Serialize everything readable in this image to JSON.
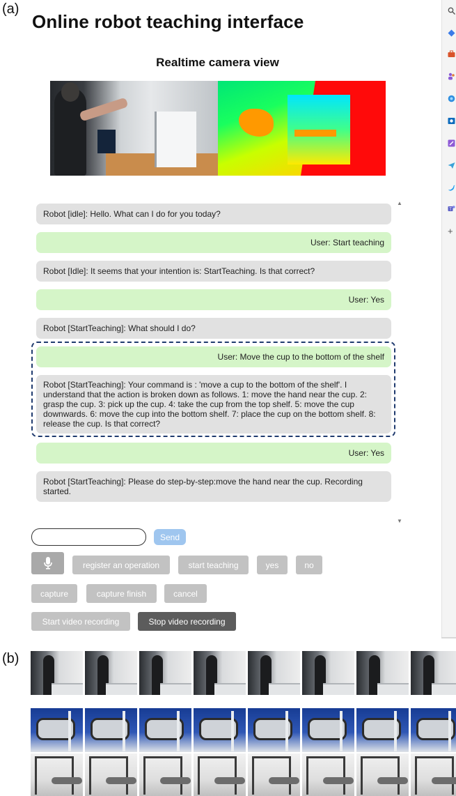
{
  "panel_labels": {
    "a": "(a)",
    "b": "(b)"
  },
  "app_title": "Online robot teaching interface",
  "camera": {
    "title": "Realtime camera view"
  },
  "chat": {
    "messages": [
      {
        "role": "robot",
        "text": "Robot [idle]: Hello. What can I do for you today?"
      },
      {
        "role": "user",
        "text": "User: Start teaching"
      },
      {
        "role": "robot",
        "text": "Robot [Idle]: It seems that your intention is: StartTeaching. Is that correct?"
      },
      {
        "role": "user",
        "text": "User: Yes"
      },
      {
        "role": "robot",
        "text": "Robot [StartTeaching]: What should I do?"
      },
      {
        "role": "user",
        "text": "User: Move the cup to the bottom of the shelf"
      },
      {
        "role": "robot",
        "text": "Robot [StartTeaching]: Your command is : 'move a cup to the bottom of the shelf'. I understand that the action is broken down as follows. 1: move the hand near the cup. 2: grasp the cup. 3: pick up the cup. 4: take the cup from the top shelf. 5: move the cup downwards. 6: move the cup into the bottom shelf. 7: place the cup on the bottom shelf. 8: release the cup. Is that correct?"
      },
      {
        "role": "user",
        "text": "User: Yes"
      },
      {
        "role": "robot",
        "text": "Robot [StartTeaching]: Please do step-by-step:move the hand near the cup. Recording started."
      }
    ]
  },
  "input": {
    "value": "",
    "placeholder": ""
  },
  "buttons": {
    "send": "Send",
    "register": "register an operation",
    "start_teaching": "start teaching",
    "yes": "yes",
    "no": "no",
    "capture": "capture",
    "capture_finish": "capture finish",
    "cancel": "cancel",
    "start_video": "Start video recording",
    "stop_video": "Stop video recording"
  },
  "sidebar_icons": [
    "search-icon",
    "diamond-icon",
    "briefcase-icon",
    "people-icon",
    "copilot-icon",
    "outlook-icon",
    "edit-icon",
    "send-icon",
    "twitter-icon",
    "teams-icon",
    "plus-icon"
  ],
  "colors": {
    "robot_bubble": "#e1e1e1",
    "user_bubble": "#d5f5c8",
    "send_button": "#9fc6ef",
    "highlight_border": "#1f3a6e",
    "stop_button": "#5c5c5c"
  },
  "frame_rows": [
    {
      "name": "human-demonstration-frames",
      "count": 8
    },
    {
      "name": "robot-simulation-frames",
      "count": 8
    },
    {
      "name": "real-robot-frames",
      "count": 8
    }
  ]
}
